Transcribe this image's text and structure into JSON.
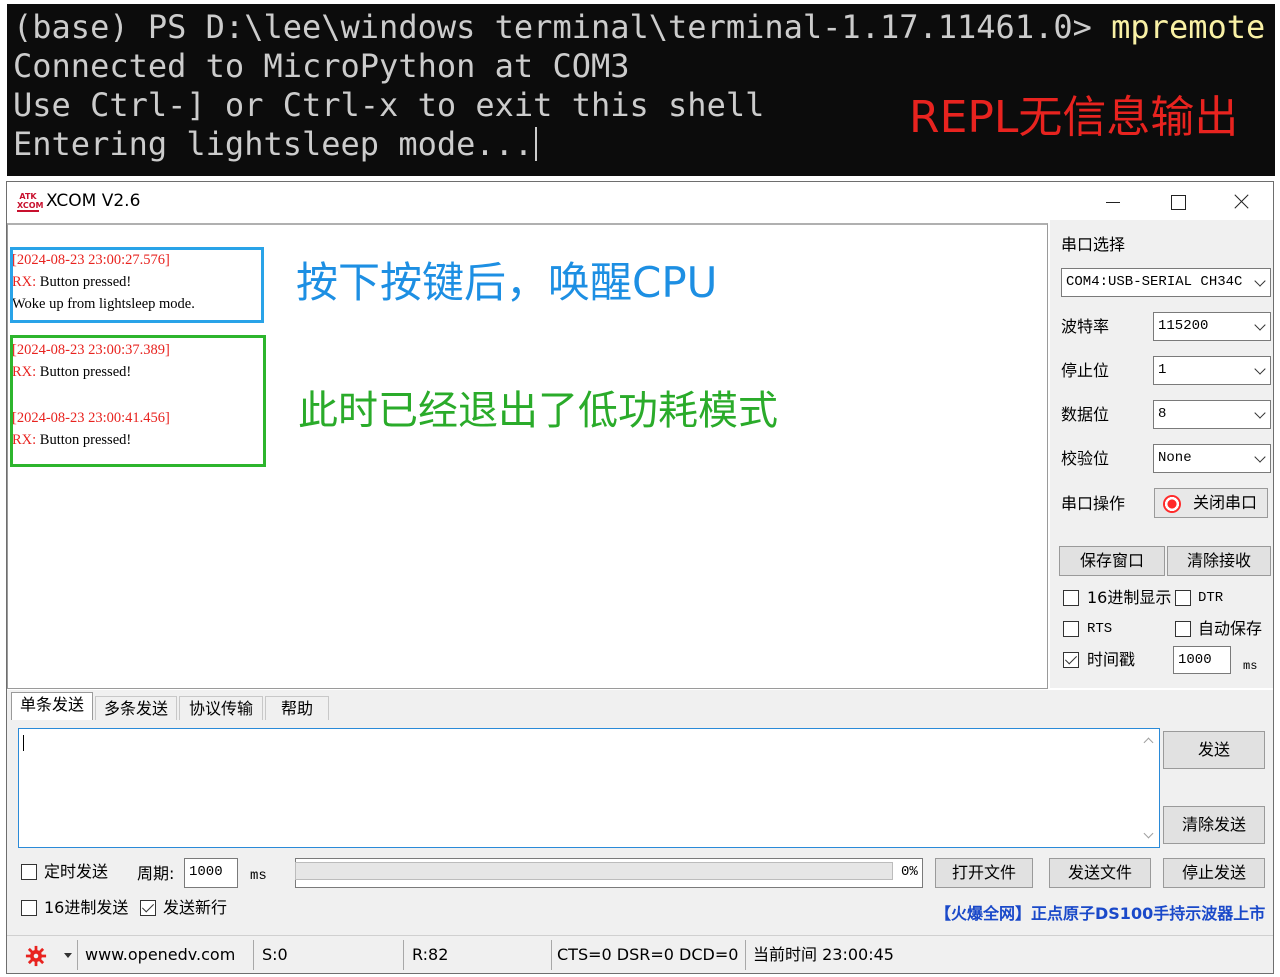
{
  "terminal": {
    "prompt": "(base) PS D:\\lee\\windows terminal\\terminal-1.17.11461.0> ",
    "command": "mpremote",
    "lines": [
      "Connected to MicroPython at COM3",
      "Use Ctrl-] or Ctrl-x to exit this shell",
      "Entering lightsleep mode..."
    ],
    "annotation": "REPL无信息输出",
    "annotation_color": "#e8231f"
  },
  "xcom": {
    "title": "XCOM V2.6",
    "logo_text": "ATK XCOM",
    "receive": {
      "blocks": [
        {
          "timestamp": "[2024-08-23 23:00:27.576]",
          "rx_label": "RX:",
          "message": " Button pressed!",
          "extra": "Woke up from lightsleep mode."
        },
        {
          "timestamp": "[2024-08-23 23:00:37.389]",
          "rx_label": "RX:",
          "message": " Button pressed!"
        },
        {
          "timestamp": "[2024-08-23 23:00:41.456]",
          "rx_label": "RX:",
          "message": " Button pressed!"
        }
      ],
      "annotation_wake": "按下按键后，唤醒CPU",
      "annotation_exit": "此时已经退出了低功耗模式",
      "wake_color": "#1d8fe3",
      "exit_color": "#2aab2a"
    },
    "settings": {
      "port_label": "串口选择",
      "port_value": "COM4:USB-SERIAL CH34C",
      "baud_label": "波特率",
      "baud_value": "115200",
      "stop_label": "停止位",
      "stop_value": "1",
      "data_label": "数据位",
      "data_value": "8",
      "parity_label": "校验位",
      "parity_value": "None",
      "op_label": "串口操作",
      "toggle_label": "关闭串口",
      "save_window": "保存窗口",
      "clear_receive": "清除接收",
      "hex_display": "16进制显示",
      "dtr": "DTR",
      "rts": "RTS",
      "auto_save": "自动保存",
      "timestamp": "时间戳",
      "timestamp_value": "1000",
      "timestamp_unit": "ms"
    },
    "tabs": [
      "单条发送",
      "多条发送",
      "协议传输",
      "帮助"
    ],
    "send": {
      "send_button": "发送",
      "clear_send": "清除发送",
      "timed_send": "定时发送",
      "period_label": "周期:",
      "period_value": "1000",
      "period_unit": "ms",
      "hex_send": "16进制发送",
      "newline": "发送新行",
      "file_path": "",
      "open_file": "打开文件",
      "send_file": "发送文件",
      "stop_send": "停止发送",
      "progress_text": "0%",
      "progress_value": 0,
      "ad_text": "【火爆全网】正点原子DS100手持示波器上市"
    },
    "status": {
      "url": "www.openedv.com",
      "sent": "S:0",
      "received": "R:82",
      "lines": "CTS=0 DSR=0 DCD=0",
      "time": "当前时间 23:00:45"
    }
  }
}
